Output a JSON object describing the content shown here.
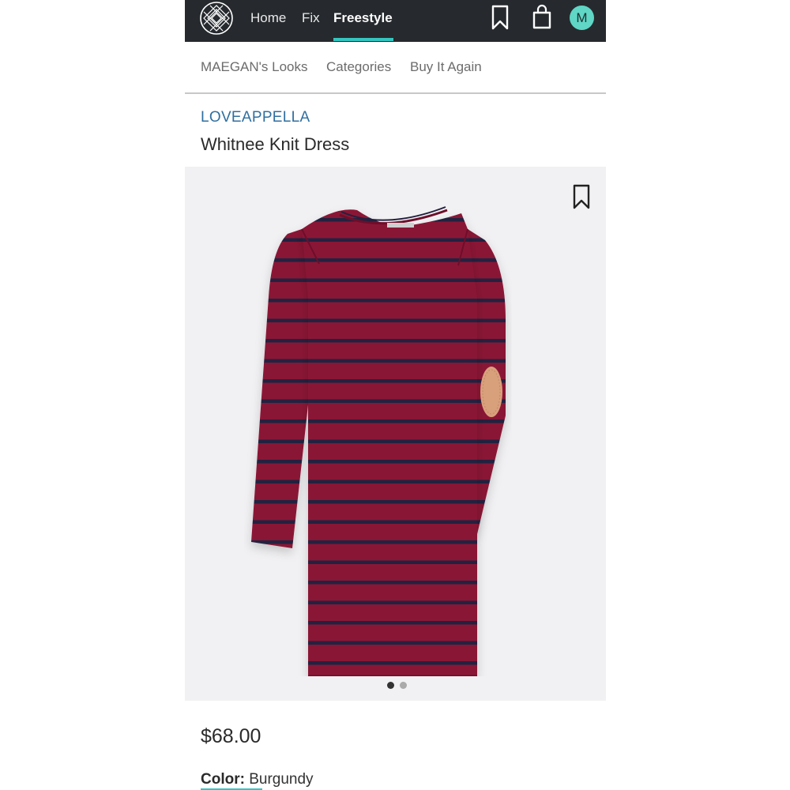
{
  "nav": {
    "home": "Home",
    "fix": "Fix",
    "freestyle": "Freestyle",
    "avatar_initial": "M"
  },
  "subnav": {
    "looks": "MAEGAN's Looks",
    "categories": "Categories",
    "buy_again": "Buy It Again"
  },
  "product": {
    "brand": "LOVEAPPELLA",
    "name": "Whitnee Knit Dress",
    "price": "$68.00",
    "color_label": "Color:",
    "color_value": "Burgundy",
    "image_count": 2,
    "active_image": 1
  },
  "colors": {
    "nav_bg": "#262a2e",
    "accent": "#36c5c0",
    "brand_text": "#2f6f9f",
    "dress_main": "#8a1235",
    "dress_stripe": "#23203f",
    "elbow_patch": "#d9a07c"
  },
  "icons": [
    "stitchfix-logo-icon",
    "bookmark-icon",
    "shopping-bag-icon",
    "save-bookmark-icon"
  ]
}
